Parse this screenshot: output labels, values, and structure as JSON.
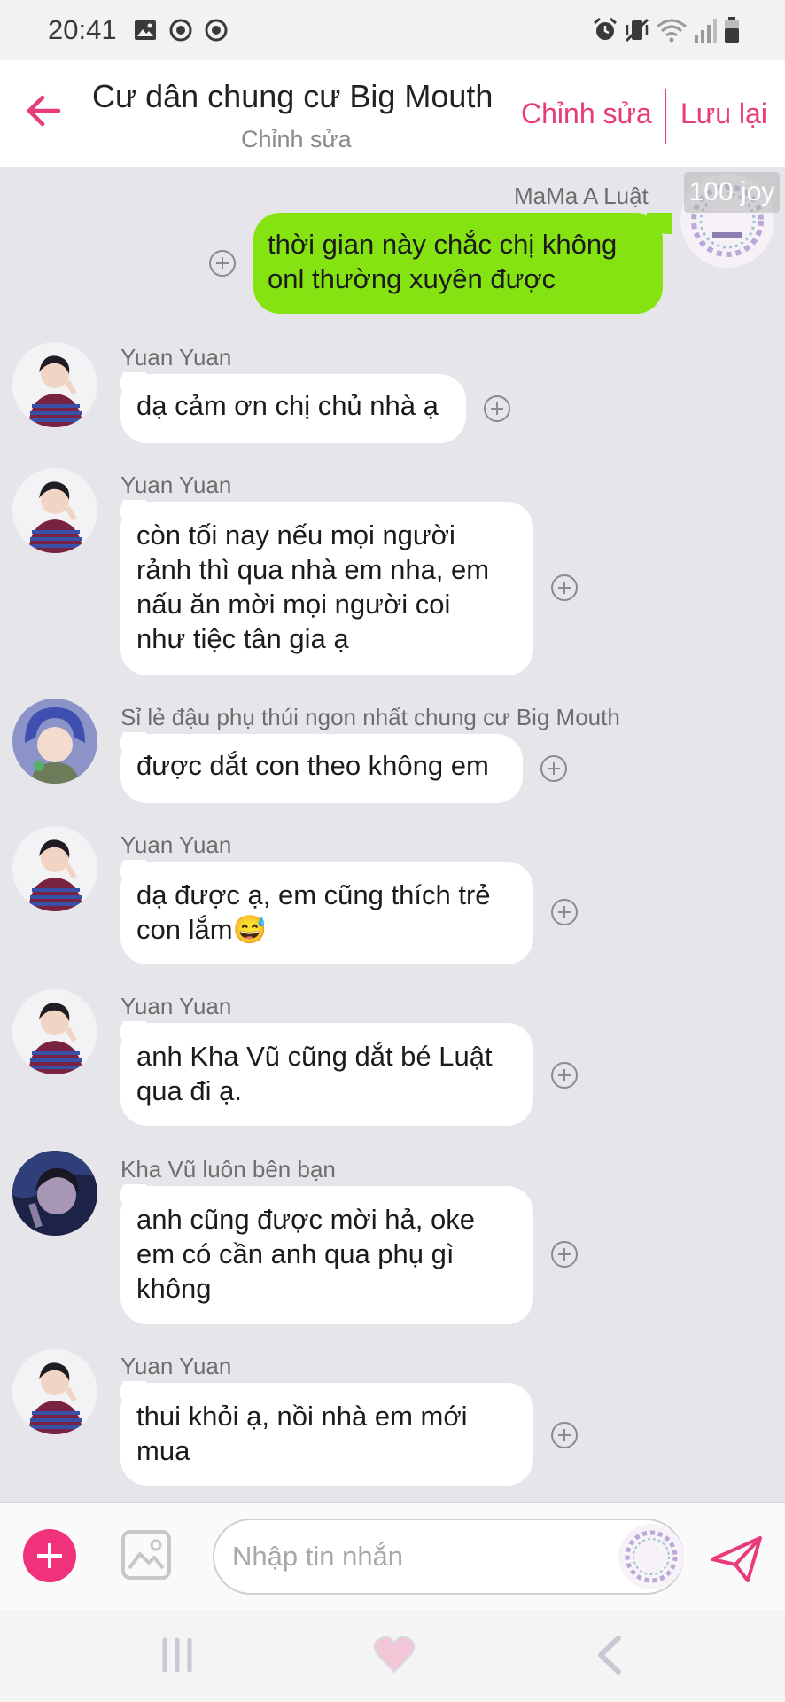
{
  "status_bar": {
    "time": "20:41",
    "left_icons": [
      "image-icon",
      "whatsapp-icon",
      "whatsapp-icon"
    ],
    "right_icons": [
      "alarm-icon",
      "vibrate-icon",
      "wifi-icon",
      "signal-icon",
      "battery-icon"
    ]
  },
  "header": {
    "title": "Cư dân chung cư Big Mouth",
    "subtitle": "Chỉnh sửa",
    "edit_label": "Chỉnh sửa",
    "save_label": "Lưu lại",
    "accent_color": "#e83b7b"
  },
  "my_message": {
    "sender": "MaMa A Luật",
    "badge": "100 joy",
    "text_line1": "thời gian này chắc chị không",
    "text_line2": "onl thường xuyên được",
    "bubble_color": "#86e312"
  },
  "messages": [
    {
      "sender": "Yuan Yuan",
      "lines": [
        "dạ cảm ơn chị chủ nhà ạ"
      ],
      "avatar": "yuan"
    },
    {
      "sender": "Yuan Yuan",
      "lines": [
        "còn tối nay nếu mọi người",
        "rảnh thì qua nhà em nha, em",
        "nấu ăn mời mọi người coi",
        "như tiệc tân gia ạ"
      ],
      "avatar": "yuan"
    },
    {
      "sender": "Sỉ lẻ đậu phụ thúi ngon nhất chung cư Big Mouth",
      "lines": [
        "được dắt con theo không em"
      ],
      "avatar": "blue"
    },
    {
      "sender": "Yuan Yuan",
      "lines": [
        "dạ được ạ, em cũng thích trẻ",
        "con lắm😅"
      ],
      "avatar": "yuan"
    },
    {
      "sender": "Yuan Yuan",
      "lines": [
        "anh Kha Vũ cũng dắt bé Luật",
        "qua đi ạ."
      ],
      "avatar": "yuan"
    },
    {
      "sender": "Kha Vũ luôn bên bạn",
      "lines": [
        "anh cũng được mời hả, oke",
        "em có cần anh qua phụ gì",
        "không"
      ],
      "avatar": "dark"
    },
    {
      "sender": "Yuan Yuan",
      "lines": [
        "thui khỏi ạ, nồi nhà em mới",
        "mua"
      ],
      "avatar": "yuan"
    }
  ],
  "composer": {
    "placeholder": "Nhập tin nhắn",
    "plus_color": "#f0327a"
  },
  "navbar": {
    "icons": [
      "recent-apps-icon",
      "home-heart-icon",
      "back-icon"
    ]
  }
}
